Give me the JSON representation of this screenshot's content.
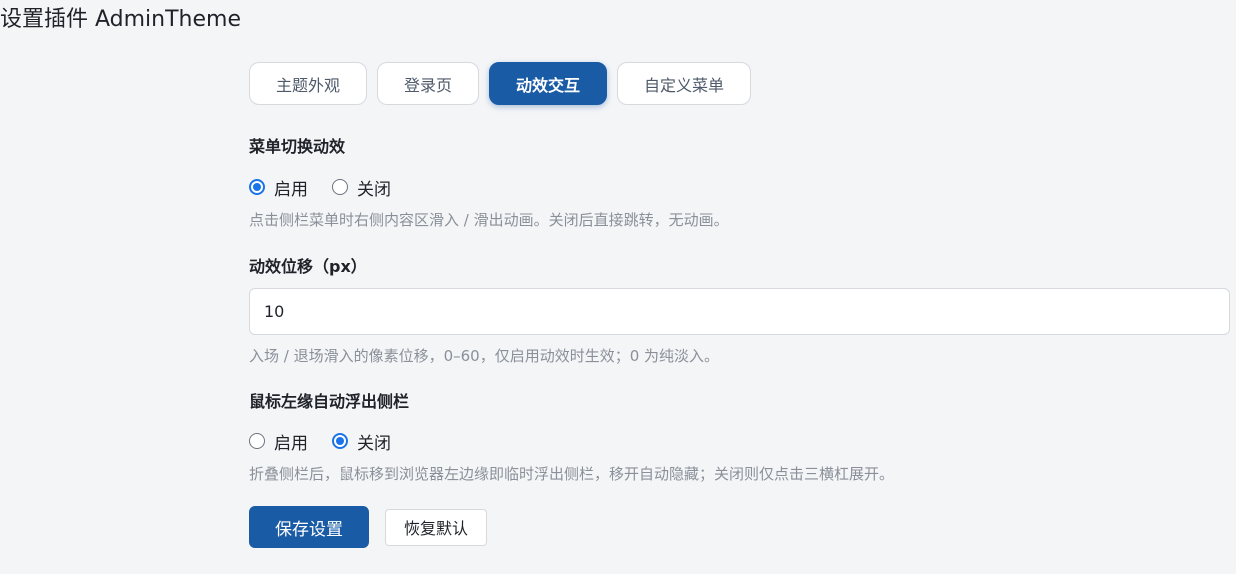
{
  "page": {
    "title": "设置插件 AdminTheme"
  },
  "tabs": [
    {
      "label": "主题外观",
      "active": false
    },
    {
      "label": "登录页",
      "active": false
    },
    {
      "label": "动效交互",
      "active": true
    },
    {
      "label": "自定义菜单",
      "active": false
    }
  ],
  "menu_animation": {
    "title": "菜单切换动效",
    "options": [
      {
        "label": "启用",
        "checked": true
      },
      {
        "label": "关闭",
        "checked": false
      }
    ],
    "hint": "点击侧栏菜单时右侧内容区滑入 / 滑出动画。关闭后直接跳转，无动画。"
  },
  "animation_offset": {
    "title": "动效位移（px）",
    "value": "10",
    "hint": "入场 / 退场滑入的像素位移，0–60，仅启用动效时生效；0 为纯淡入。"
  },
  "edge_hover": {
    "title": "鼠标左缘自动浮出侧栏",
    "options": [
      {
        "label": "启用",
        "checked": false
      },
      {
        "label": "关闭",
        "checked": true
      }
    ],
    "hint": "折叠侧栏后，鼠标移到浏览器左边缘即临时浮出侧栏，移开自动隐藏；关闭则仅点击三横杠展开。"
  },
  "actions": {
    "save_label": "保存设置",
    "reset_label": "恢复默认"
  },
  "colors": {
    "accent": "#1a5ba6",
    "radio_checked": "#1a73e8",
    "background": "#f4f5f7"
  }
}
